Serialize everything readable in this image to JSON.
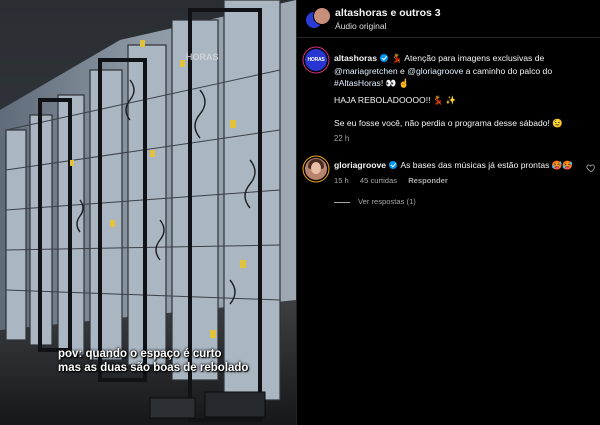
{
  "video": {
    "brand_watermark": "HORAS",
    "caption_line1": "pov: quando o espaço é curto",
    "caption_line2": "mas as duas são boas de rebolado"
  },
  "header": {
    "title": "altashoras e outros 3",
    "subtitle": "Áudio original"
  },
  "post": {
    "username": "altashoras",
    "avatar_logo": "HORAS",
    "text_intro": "Atenção para imagens exclusivas de",
    "mention1": "@mariagretchen",
    "text_and": "e",
    "mention2": "@gloriagroove",
    "text_tail": "a caminho do palco do",
    "hashtag": "#AltasHoras",
    "emoji_line1": "👀 ☝️",
    "line2": "HAJA REBOLADOOOO!!",
    "line2_emoji": "💃 ✨",
    "line3": "Se eu fosse você, não perdia o programa desse sábado!",
    "line3_emoji": "😉",
    "time": "22 h"
  },
  "comment": {
    "username": "gloriagroove",
    "text": "As bases das músicas já estão prontas",
    "text_emoji": "🥵🥵",
    "time": "15 h",
    "likes": "45 curtidas",
    "reply_label": "Responder",
    "view_replies": "Ver respostas (1)"
  },
  "colors": {
    "background": "#000000",
    "verified_blue": "#0095f6",
    "secondary_text": "#a8a8a8",
    "avatar_blue": "#2735d3"
  },
  "icons": [
    "verified-badge-icon",
    "heart-icon"
  ]
}
